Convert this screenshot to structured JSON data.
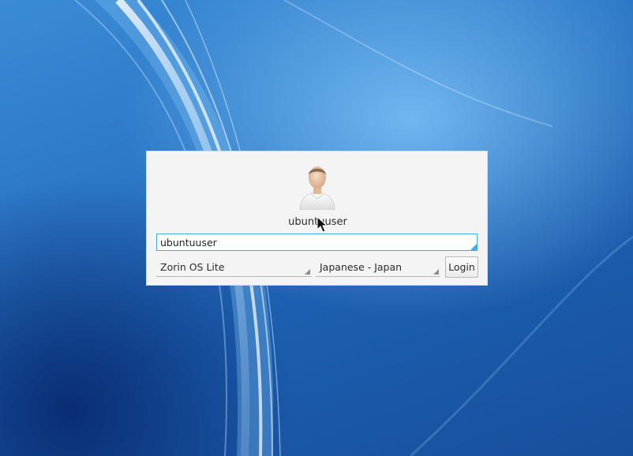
{
  "login": {
    "username_label": "ubuntuuser",
    "username_value": "ubuntuuser",
    "session": "Zorin OS Lite",
    "language": "Japanese - Japan",
    "login_button": "Login"
  },
  "icons": {
    "avatar": "user-avatar-icon",
    "pointer": "mouse-pointer-icon"
  },
  "colors": {
    "focus_accent": "#3daee9",
    "panel_background": "#f4f4f4",
    "wallpaper_base": "#2d79c8"
  }
}
